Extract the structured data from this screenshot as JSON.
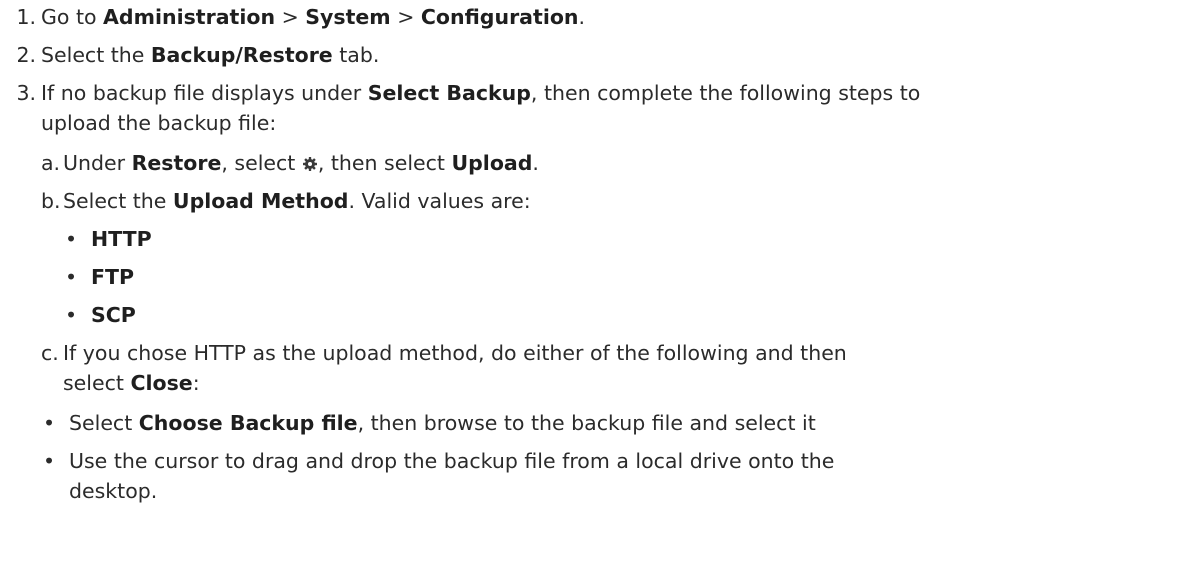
{
  "steps": {
    "s1": {
      "num": "1.",
      "t1": "Go to ",
      "b1": "Administration",
      "t2": " > ",
      "b2": "System",
      "t3": " > ",
      "b3": "Configuration",
      "t4": "."
    },
    "s2": {
      "num": "2.",
      "t1": "Select the ",
      "b1": "Backup/Restore",
      "t2": " tab."
    },
    "s3": {
      "num": "3.",
      "t1": "If no backup file displays under ",
      "b1": "Select Backup",
      "t2": ", then complete the following steps to",
      "t3": "upload the backup file:"
    }
  },
  "substeps": {
    "a": {
      "letter": "a.",
      "t1": "Under ",
      "b1": "Restore",
      "t2": ", select ",
      "t3": ", then select ",
      "b2": "Upload",
      "t4": ".",
      "icon": "gear-icon"
    },
    "b": {
      "letter": "b.",
      "t1": "Select the ",
      "b1": "Upload Method",
      "t2": ". Valid values are:",
      "bullets": [
        "HTTP",
        "FTP",
        "SCP"
      ]
    },
    "c": {
      "letter": "c.",
      "t1": "If you chose HTTP as the upload method, do either of the following and then",
      "t2": "select ",
      "b1": "Close",
      "t3": ":",
      "bullet1": {
        "t1": "Select ",
        "b1": "Choose Backup file",
        "t2": ", then browse to the backup file and select it"
      },
      "bullet2": {
        "line1": "Use the cursor to drag and drop the backup file from a local drive onto the",
        "line2": "desktop."
      }
    }
  },
  "bullet_glyph": "•",
  "colors": {
    "text": "#2b2b2b",
    "icon": "#3a3a3a"
  }
}
